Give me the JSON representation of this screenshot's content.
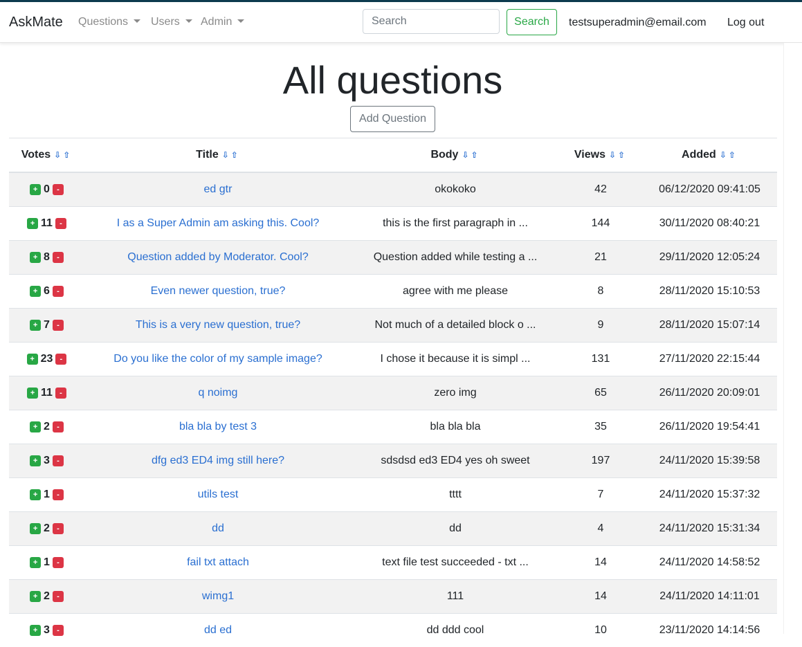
{
  "navbar": {
    "brand": "AskMate",
    "menus": [
      {
        "label": "Questions"
      },
      {
        "label": "Users"
      },
      {
        "label": "Admin"
      }
    ],
    "search_placeholder": "Search",
    "search_button": "Search",
    "user_email": "testsuperadmin@email.com",
    "logout": "Log out"
  },
  "page": {
    "title": "All questions",
    "add_question": "Add Question"
  },
  "table": {
    "sort_icons": "⇩⇧",
    "vote_up": "+",
    "vote_down": "-",
    "headers": {
      "votes": "Votes",
      "title": "Title",
      "body": "Body",
      "views": "Views",
      "added": "Added"
    },
    "rows": [
      {
        "votes": "0",
        "title": "ed gtr",
        "body": "okokoko",
        "views": "42",
        "added": "06/12/2020 09:41:05"
      },
      {
        "votes": "11",
        "title": "I as a Super Admin am asking this. Cool?",
        "body": "this is the first paragraph in ...",
        "views": "144",
        "added": "30/11/2020 08:40:21"
      },
      {
        "votes": "8",
        "title": "Question added by Moderator. Cool?",
        "body": "Question added while testing a ...",
        "views": "21",
        "added": "29/11/2020 12:05:24"
      },
      {
        "votes": "6",
        "title": "Even newer question, true?",
        "body": "agree with me please",
        "views": "8",
        "added": "28/11/2020 15:10:53"
      },
      {
        "votes": "7",
        "title": "This is a very new question, true?",
        "body": "Not much of a detailed block o ...",
        "views": "9",
        "added": "28/11/2020 15:07:14"
      },
      {
        "votes": "23",
        "title": "Do you like the color of my sample image?",
        "body": "I chose it because it is simpl ...",
        "views": "131",
        "added": "27/11/2020 22:15:44"
      },
      {
        "votes": "11",
        "title": "q noimg",
        "body": "zero img",
        "views": "65",
        "added": "26/11/2020 20:09:01"
      },
      {
        "votes": "2",
        "title": "bla bla by test 3",
        "body": "bla bla bla",
        "views": "35",
        "added": "26/11/2020 19:54:41"
      },
      {
        "votes": "3",
        "title": "dfg ed3 ED4 img still here?",
        "body": "sdsdsd ed3 ED4 yes oh sweet",
        "views": "197",
        "added": "24/11/2020 15:39:58"
      },
      {
        "votes": "1",
        "title": "utils test",
        "body": "tttt",
        "views": "7",
        "added": "24/11/2020 15:37:32"
      },
      {
        "votes": "2",
        "title": "dd",
        "body": "dd",
        "views": "4",
        "added": "24/11/2020 15:31:34"
      },
      {
        "votes": "1",
        "title": "fail txt attach",
        "body": "text file test succeeded - txt ...",
        "views": "14",
        "added": "24/11/2020 14:58:52"
      },
      {
        "votes": "2",
        "title": "wimg1",
        "body": "111",
        "views": "14",
        "added": "24/11/2020 14:11:01"
      },
      {
        "votes": "3",
        "title": "dd ed",
        "body": "dd ddd cool",
        "views": "10",
        "added": "23/11/2020 14:14:56"
      }
    ]
  }
}
